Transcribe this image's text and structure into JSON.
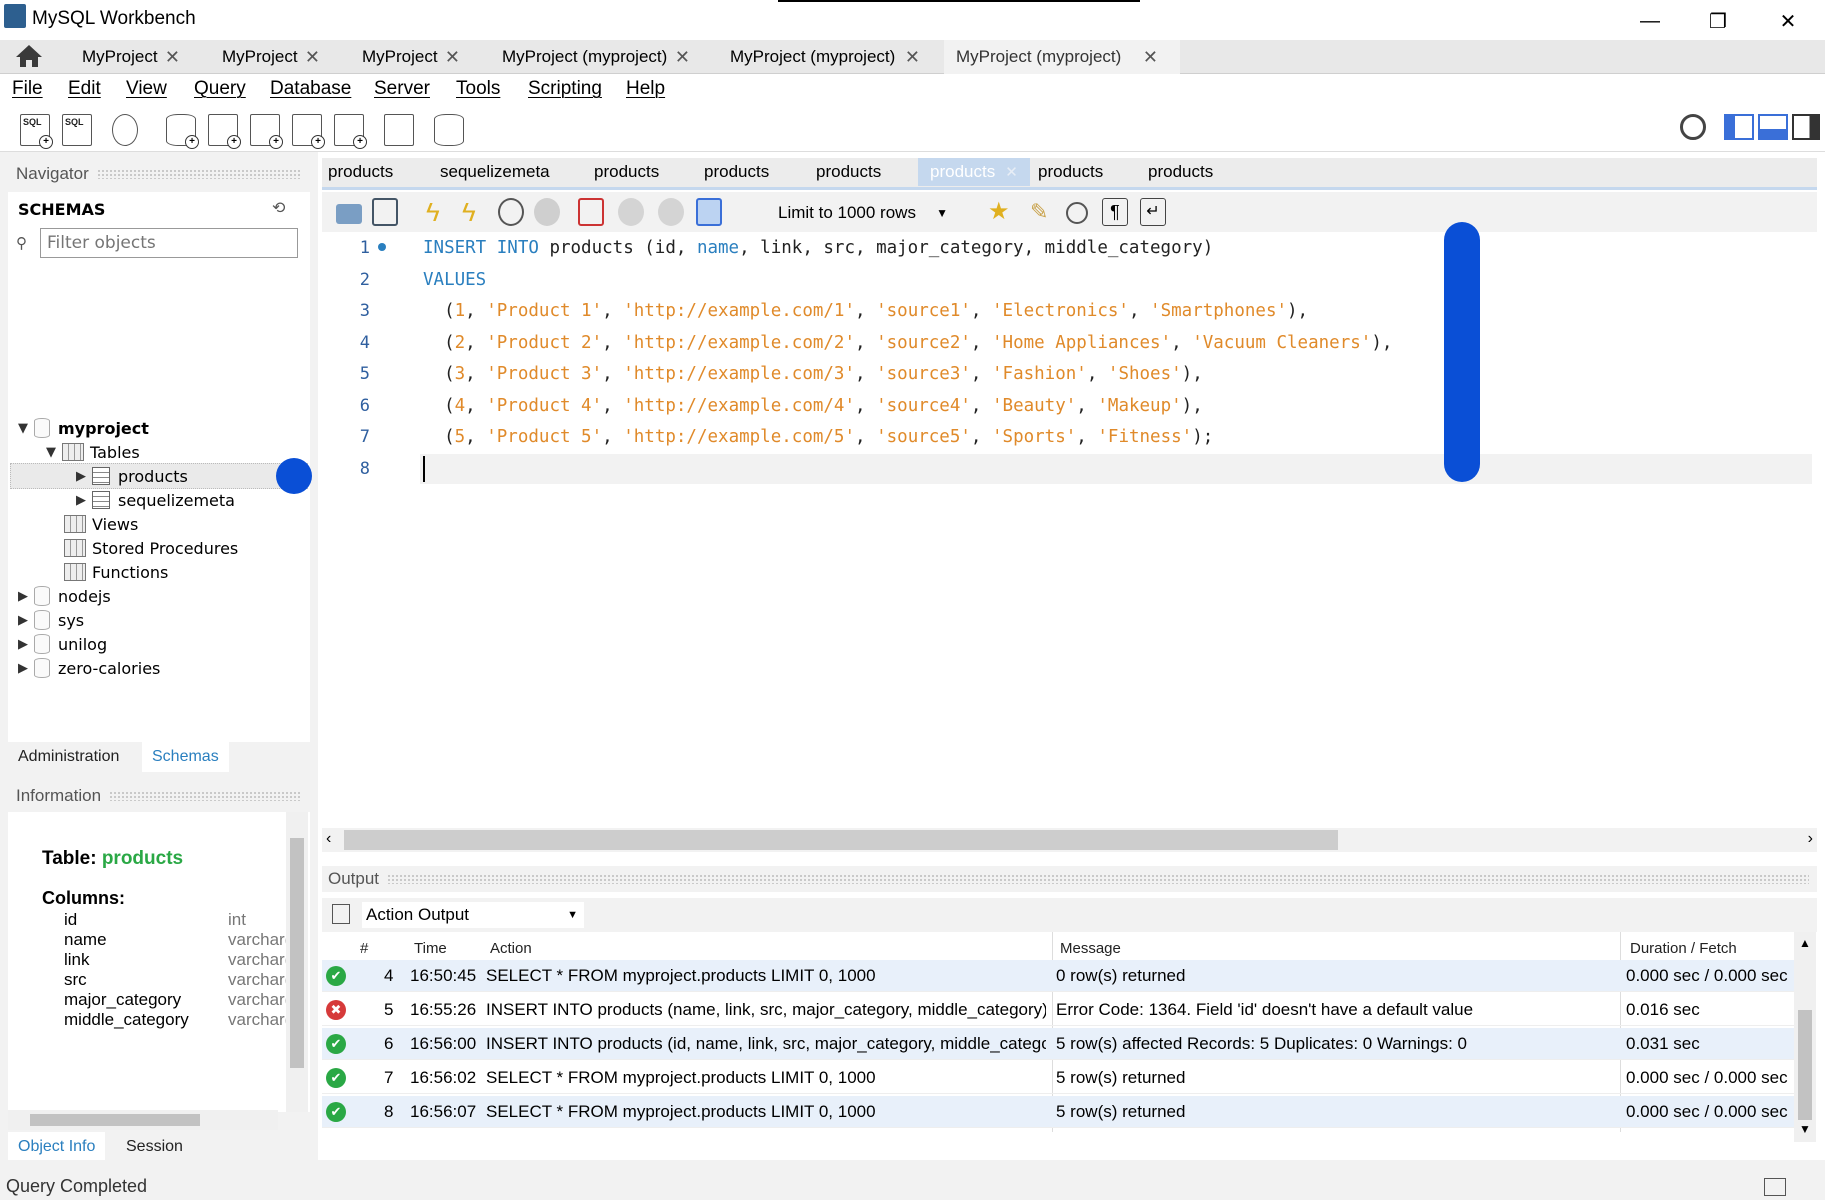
{
  "window": {
    "title": "MySQL Workbench",
    "minimize": "—",
    "restore": "❐",
    "close": "✕"
  },
  "conn_tabs": [
    "MyProject",
    "MyProject",
    "MyProject",
    "MyProject (myproject)",
    "MyProject (myproject)",
    "MyProject (myproject)"
  ],
  "menu": [
    "File",
    "Edit",
    "View",
    "Query",
    "Database",
    "Server",
    "Tools",
    "Scripting",
    "Help"
  ],
  "navigator": {
    "title": "Navigator",
    "schemas_label": "SCHEMAS",
    "filter_placeholder": "Filter objects",
    "tree": {
      "myproject": "myproject",
      "tables": "Tables",
      "products": "products",
      "sequelizemeta": "sequelizemeta",
      "views": "Views",
      "stored_procedures": "Stored Procedures",
      "functions": "Functions",
      "nodejs": "nodejs",
      "sys": "sys",
      "unilog": "unilog",
      "zero_calories": "zero-calories"
    },
    "tabs": {
      "administration": "Administration",
      "schemas": "Schemas"
    }
  },
  "information": {
    "title": "Information",
    "table_label": "Table:",
    "table_name": "products",
    "columns_label": "Columns:",
    "columns": [
      {
        "name": "id",
        "type": "int"
      },
      {
        "name": "name",
        "type": "varchar("
      },
      {
        "name": "link",
        "type": "varchar("
      },
      {
        "name": "src",
        "type": "varchar("
      },
      {
        "name": "major_category",
        "type": "varchar("
      },
      {
        "name": "middle_category",
        "type": "varchar("
      }
    ],
    "tabs": {
      "object_info": "Object Info",
      "session": "Session"
    }
  },
  "editor_tabs": [
    "products",
    "sequelizemeta",
    "products",
    "products",
    "products",
    "products",
    "products",
    "products"
  ],
  "editor_toolbar": {
    "limit": "Limit to 1000 rows"
  },
  "code_lines": [
    "1",
    "2",
    "3",
    "4",
    "5",
    "6",
    "7",
    "8"
  ],
  "code": {
    "l1_kw": "INSERT INTO",
    "l1_a": " products (id, ",
    "l1_name": "name",
    "l1_b": ", link, src, major_category, middle_category)",
    "l2_kw": "VALUES",
    "rows": [
      {
        "n": "1",
        "p": "'Product 1'",
        "u": "'http://example.com/1'",
        "s": "'source1'",
        "c1": "'Electronics'",
        "c2": "'Smartphones'",
        "end": "),"
      },
      {
        "n": "2",
        "p": "'Product 2'",
        "u": "'http://example.com/2'",
        "s": "'source2'",
        "c1": "'Home Appliances'",
        "c2": "'Vacuum Cleaners'",
        "end": "),"
      },
      {
        "n": "3",
        "p": "'Product 3'",
        "u": "'http://example.com/3'",
        "s": "'source3'",
        "c1": "'Fashion'",
        "c2": "'Shoes'",
        "end": "),"
      },
      {
        "n": "4",
        "p": "'Product 4'",
        "u": "'http://example.com/4'",
        "s": "'source4'",
        "c1": "'Beauty'",
        "c2": "'Makeup'",
        "end": "),"
      },
      {
        "n": "5",
        "p": "'Product 5'",
        "u": "'http://example.com/5'",
        "s": "'source5'",
        "c1": "'Sports'",
        "c2": "'Fitness'",
        "end": ");"
      }
    ]
  },
  "output": {
    "title": "Output",
    "mode": "Action Output",
    "headers": {
      "num": "#",
      "time": "Time",
      "action": "Action",
      "message": "Message",
      "duration": "Duration / Fetch"
    },
    "rows": [
      {
        "status": "ok",
        "num": "4",
        "time": "16:50:45",
        "action": "SELECT * FROM myproject.products LIMIT 0, 1000",
        "message": "0 row(s) returned",
        "duration": "0.000 sec / 0.000 sec"
      },
      {
        "status": "error",
        "num": "5",
        "time": "16:55:26",
        "action": "INSERT INTO products (name, link, src, major_category, middle_category) V...",
        "message": "Error Code: 1364. Field 'id' doesn't have a default value",
        "duration": "0.016 sec"
      },
      {
        "status": "ok",
        "num": "6",
        "time": "16:56:00",
        "action": "INSERT INTO products (id, name, link, src, major_category, middle_category...",
        "message": "5 row(s) affected Records: 5  Duplicates: 0  Warnings: 0",
        "duration": "0.031 sec"
      },
      {
        "status": "ok",
        "num": "7",
        "time": "16:56:02",
        "action": "SELECT * FROM myproject.products LIMIT 0, 1000",
        "message": "5 row(s) returned",
        "duration": "0.000 sec / 0.000 sec"
      },
      {
        "status": "ok",
        "num": "8",
        "time": "16:56:07",
        "action": "SELECT * FROM myproject.products LIMIT 0, 1000",
        "message": "5 row(s) returned",
        "duration": "0.000 sec / 0.000 sec"
      }
    ]
  },
  "status_text": "Query Completed",
  "colors": {
    "accent_blue": "#0a4fd6",
    "ok_green": "#2aa845",
    "error_red": "#d63a3a"
  }
}
